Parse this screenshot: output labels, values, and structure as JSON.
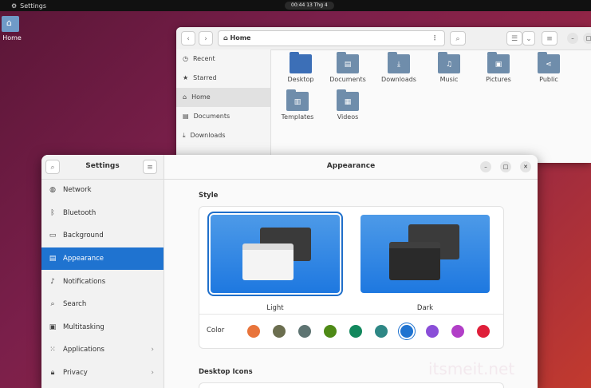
{
  "topbar": {
    "app_name": "Settings",
    "clock": "00:44  13 Thg 4"
  },
  "desktop": {
    "home_label": "Home"
  },
  "files": {
    "path": "Home",
    "sidebar": [
      {
        "label": "Recent",
        "icon": "clock-icon"
      },
      {
        "label": "Starred",
        "icon": "star-icon"
      },
      {
        "label": "Home",
        "icon": "home-icon",
        "selected": true
      },
      {
        "label": "Documents",
        "icon": "document-icon"
      },
      {
        "label": "Downloads",
        "icon": "download-icon"
      }
    ],
    "folders": [
      "Desktop",
      "Documents",
      "Downloads",
      "Music",
      "Pictures",
      "Public",
      "Templates",
      "Videos"
    ]
  },
  "settings": {
    "sidebar_title": "Settings",
    "page_title": "Appearance",
    "nav": [
      {
        "label": "Network",
        "icon": "globe-icon"
      },
      {
        "label": "Bluetooth",
        "icon": "bluetooth-icon"
      },
      {
        "label": "Background",
        "icon": "monitor-icon"
      },
      {
        "label": "Appearance",
        "icon": "appearance-icon",
        "selected": true
      },
      {
        "label": "Notifications",
        "icon": "bell-icon"
      },
      {
        "label": "Search",
        "icon": "search-icon"
      },
      {
        "label": "Multitasking",
        "icon": "multitasking-icon"
      },
      {
        "label": "Applications",
        "icon": "grid-icon",
        "chevron": true
      },
      {
        "label": "Privacy",
        "icon": "lock-icon",
        "chevron": true
      }
    ],
    "style_title": "Style",
    "style_light": "Light",
    "style_dark": "Dark",
    "color_label": "Color",
    "colors": [
      "#e8743b",
      "#6b6e4f",
      "#5e7472",
      "#4e8a16",
      "#12885d",
      "#2e8785",
      "#1f73d0",
      "#8a4ed8",
      "#b13ec7",
      "#df1f3a"
    ],
    "selected_color_index": 6,
    "desktop_icons_title": "Desktop Icons"
  },
  "watermark": "itsmeit.net"
}
